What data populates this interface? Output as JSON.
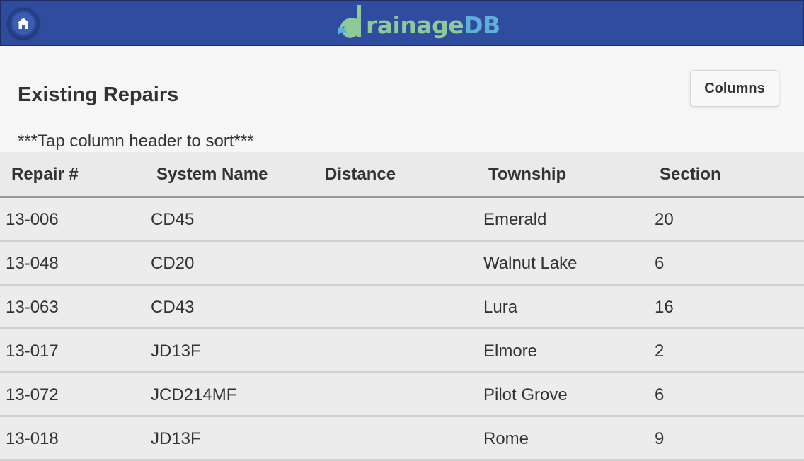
{
  "header": {
    "logo_text_a": "rainage",
    "logo_text_b": "DB",
    "logo_lettering": "DrainageDB"
  },
  "page": {
    "title": "Existing Repairs",
    "columns_button": "Columns",
    "hint": "***Tap column header to sort***"
  },
  "table": {
    "headers": [
      "Repair #",
      "System Name",
      "Distance",
      "Township",
      "Section"
    ],
    "rows": [
      [
        "13-006",
        "CD45",
        "",
        "Emerald",
        "20"
      ],
      [
        "13-048",
        "CD20",
        "",
        "Walnut Lake",
        "6"
      ],
      [
        "13-063",
        "CD43",
        "",
        "Lura",
        "16"
      ],
      [
        "13-017",
        "JD13F",
        "",
        "Elmore",
        "2"
      ],
      [
        "13-072",
        "JCD214MF",
        "",
        "Pilot Grove",
        "6"
      ],
      [
        "13-018",
        "JD13F",
        "",
        "Rome",
        "9"
      ]
    ]
  },
  "colors": {
    "topbar": "#2f4c9e",
    "logo_green": "#8ec99a",
    "logo_blue": "#5fb0d8"
  },
  "icons": {
    "home": "home-icon"
  }
}
